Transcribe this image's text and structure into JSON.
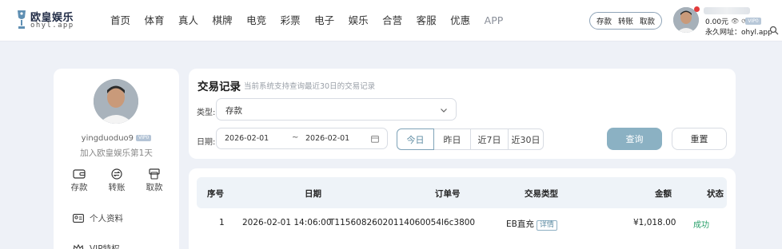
{
  "brand": {
    "name": "欧皇娱乐",
    "domain": "ohyl.app"
  },
  "nav": [
    "首页",
    "体育",
    "真人",
    "棋牌",
    "电竞",
    "彩票",
    "电子",
    "娱乐",
    "合营",
    "客服",
    "优惠",
    "APP"
  ],
  "quick_actions": [
    "存款",
    "转账",
    "取款"
  ],
  "account": {
    "balance": "0.00元",
    "vip_badge": "VIP0",
    "permanent_url": "永久网址：ohyl.app"
  },
  "sidebar": {
    "username": "yingduoduo9",
    "vip": "VIP0",
    "join_text": "加入欧皇娱乐第1天",
    "actions": [
      {
        "label": "存款",
        "icon": "wallet-icon"
      },
      {
        "label": "转账",
        "icon": "transfer-icon"
      },
      {
        "label": "取款",
        "icon": "withdraw-icon"
      }
    ],
    "menu": [
      {
        "label": "个人资料",
        "icon": "id-card-icon"
      },
      {
        "label": "VIP特权",
        "icon": "vip-crown-icon"
      }
    ]
  },
  "filter": {
    "title": "交易记录",
    "hint": "当前系统支持查询最近30日的交易记录",
    "type_label": "类型:",
    "type_value": "存款",
    "date_label": "日期:",
    "date_start": "2026-02-01",
    "date_sep": "~",
    "date_end": "2026-02-01",
    "ranges": [
      "今日",
      "昨日",
      "近7日",
      "近30日"
    ],
    "active_range": "今日",
    "query_label": "查询",
    "reset_label": "重置"
  },
  "table": {
    "headers": [
      "序号",
      "日期",
      "订单号",
      "交易类型",
      "金额",
      "状态"
    ],
    "rows": [
      {
        "index": "1",
        "date": "2026-02-01 14:06:00",
        "order": "T11560826020114060054l6c3800",
        "type": "EB直充",
        "detail": "详情",
        "amount": "¥1,018.00",
        "status": "成功"
      }
    ]
  },
  "colors": {
    "accent": "#8bb1c3",
    "success": "#28a06a",
    "page_bg": "#eef1f7"
  }
}
